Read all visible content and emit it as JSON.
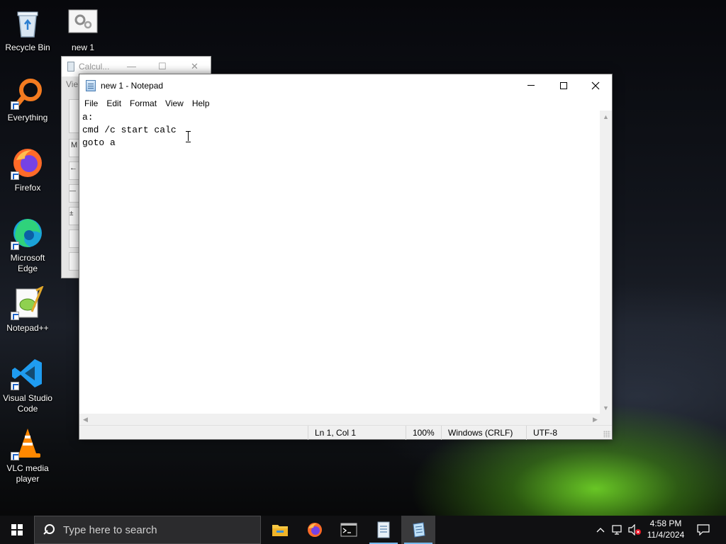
{
  "desktop": {
    "icons": [
      {
        "label": "Recycle Bin"
      },
      {
        "label": "new 1"
      },
      {
        "label": "Everything"
      },
      {
        "label": "Firefox"
      },
      {
        "label": "Microsoft Edge"
      },
      {
        "label": "Notepad++"
      },
      {
        "label": "Visual Studio Code"
      },
      {
        "label": "VLC media player"
      }
    ]
  },
  "calculator": {
    "title": "Calcul...",
    "menu_hint": "Vie",
    "button_hints": [
      "M",
      "←",
      "—",
      "±"
    ]
  },
  "notepad": {
    "title": "new 1 - Notepad",
    "menu": [
      "File",
      "Edit",
      "Format",
      "View",
      "Help"
    ],
    "content": "a:\ncmd /c start calc\ngoto a",
    "status": {
      "position": "Ln 1, Col 1",
      "zoom": "100%",
      "line_ending": "Windows (CRLF)",
      "encoding": "UTF-8"
    }
  },
  "taskbar": {
    "search_placeholder": "Type here to search",
    "pinned": [
      "File Explorer",
      "Firefox",
      "Command Prompt",
      "Notepad++",
      "Notepad"
    ],
    "active_app": "Notepad",
    "clock": {
      "time": "4:58 PM",
      "date": "11/4/2024"
    }
  },
  "colors": {
    "accent": "#76b9ed",
    "taskbar": "#101012",
    "search_box": "#2b2b2d"
  }
}
